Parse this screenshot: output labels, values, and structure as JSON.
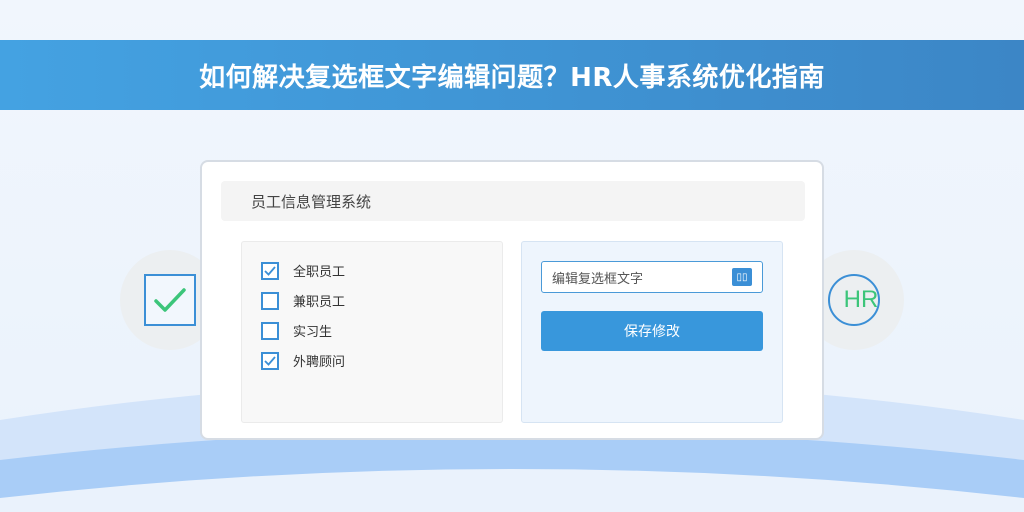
{
  "banner": {
    "title": "如何解决复选框文字编辑问题？HR人事系统优化指南"
  },
  "card": {
    "title": "员工信息管理系统",
    "checkboxes": [
      {
        "label": "全职员工",
        "checked": true
      },
      {
        "label": "兼职员工",
        "checked": false
      },
      {
        "label": "实习生",
        "checked": false
      },
      {
        "label": "外聘顾问",
        "checked": true
      }
    ],
    "editor": {
      "input_value": "编辑复选框文字",
      "icon_glyph": "▯▯",
      "save_label": "保存修改"
    }
  },
  "decor": {
    "left_icon": "checkbox-check-icon",
    "right_icon": "hr-logo-icon",
    "right_icon_text": "HR"
  },
  "colors": {
    "banner": "#3f93d3",
    "accent": "#3b8fd6",
    "check_green": "#3cc57a",
    "save_button": "#3897dc"
  }
}
